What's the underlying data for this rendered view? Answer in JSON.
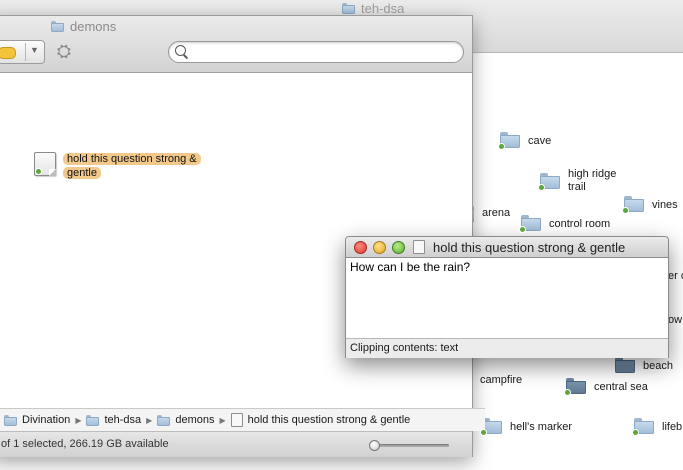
{
  "background_window": {
    "title": "teh-dsa",
    "items": [
      {
        "label": "cave"
      },
      {
        "label": "high ridge trail"
      },
      {
        "label": "vines"
      },
      {
        "label": "arena"
      },
      {
        "label": "control room"
      },
      {
        "label": "er c"
      },
      {
        "label": "ow"
      },
      {
        "label": "beach"
      },
      {
        "label": "campfire"
      },
      {
        "label": "central sea"
      },
      {
        "label": "hell's marker"
      },
      {
        "label": "lifeb"
      }
    ]
  },
  "finder": {
    "title": "demons",
    "search": {
      "value": "",
      "placeholder": ""
    },
    "selected_file": "hold this question strong & gentle",
    "path": [
      "Divination",
      "teh-dsa",
      "demons",
      "hold this question strong & gentle"
    ],
    "status": "of 1 selected, 266.19 GB available",
    "icon_size": 0.0
  },
  "clipping_window": {
    "title": "hold this question strong & gentle",
    "content": "How can I be the rain?",
    "footer": "Clipping contents: text"
  },
  "colors": {
    "selection_highlight": "#f2c98a",
    "accent_yellow": "#f3c33a"
  }
}
